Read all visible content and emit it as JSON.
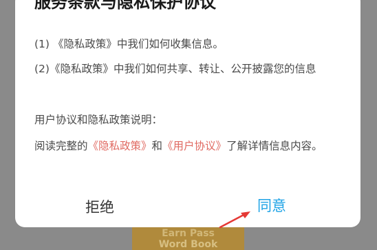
{
  "dialog": {
    "title": "服务条款与隐私保护协议",
    "item1": "(1) 《隐私政策》中我们如何收集信息。",
    "item2": "(2)《隐私政策》中我们如何共享、转让、公开披露您的信息",
    "section_heading": "用户协议和隐私政策说明：",
    "read_prefix": "阅读完整的",
    "privacy_link": "《隐私政策》",
    "and_text": "和",
    "user_agreement_link": "《用户协议》",
    "read_suffix": "了解详情信息内容。",
    "reject_label": "拒绝",
    "agree_label": "同意"
  },
  "background": {
    "line1": "Earn Pass",
    "line2": "Word Book"
  },
  "colors": {
    "link": "#e06a62",
    "agree": "#1ea3e6",
    "arrow": "#e53935"
  }
}
